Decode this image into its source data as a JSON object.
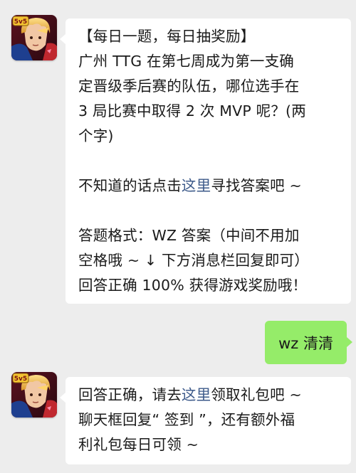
{
  "messages": [
    {
      "sender": "bot",
      "paragraphs": [
        {
          "lines": [
            "【每日一题，每日抽奖励】",
            "广州 TTG 在第七周成为第一支确",
            "定晋级季后赛的队伍，哪位选手在",
            "3 局比赛中取得 2 次 MVP 呢？(两",
            "个字)"
          ]
        },
        {
          "before": "不知道的话点击",
          "link": "这里",
          "after": "寻找答案吧 ~"
        },
        {
          "lines": [
            "答题格式：WZ 答案（中间不用加",
            "空格哦 ~ ↓ 下方消息栏回复即可）",
            "回答正确 100% 获得游戏奖励哦！"
          ]
        }
      ]
    },
    {
      "sender": "user",
      "text": "wz 清清"
    },
    {
      "sender": "bot",
      "line1_before": "回答正确，请去",
      "line1_link": "这里",
      "line1_after": "领取礼包吧 ~",
      "line2": "聊天框回复“ 签到 ”，还有额外福",
      "line3": "利礼包每日可领 ~"
    }
  ],
  "colors": {
    "chat_background": "#ededed",
    "bot_bubble": "#ffffff",
    "user_bubble": "#95ec69",
    "link": "#3d5a8a"
  },
  "icons": {
    "bot_avatar": "honor-of-kings-5v5-avatar"
  }
}
